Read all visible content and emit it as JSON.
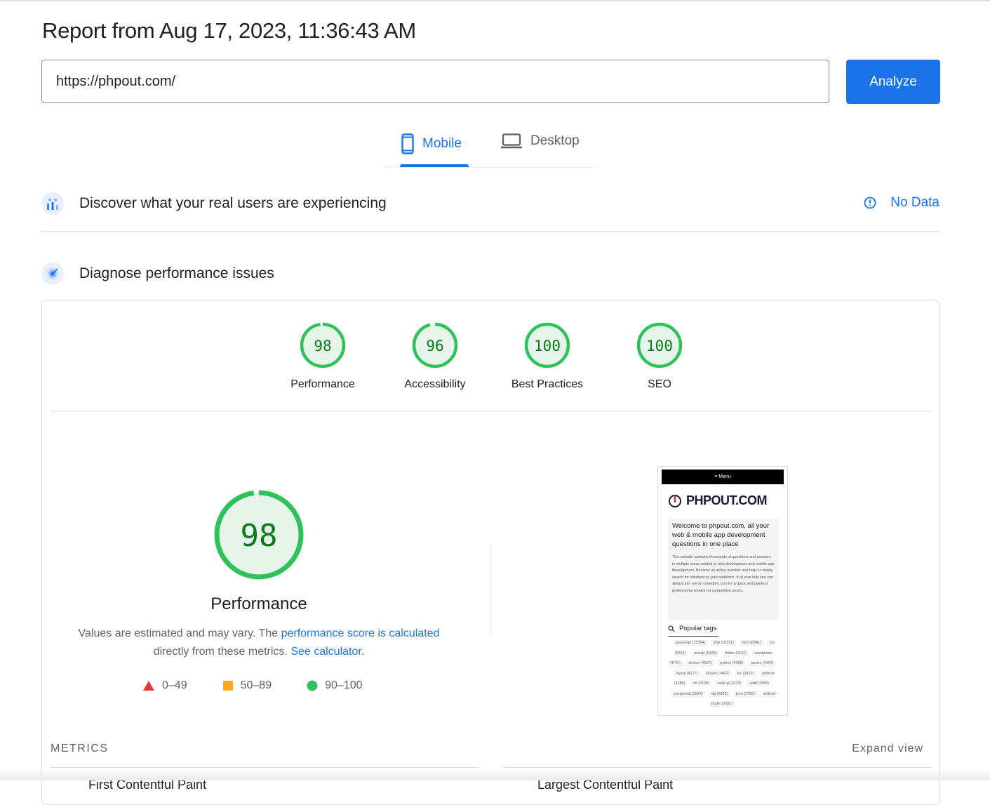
{
  "report": {
    "title": "Report from Aug 17, 2023, 11:36:43 AM"
  },
  "search": {
    "url_value": "https://phpout.com/",
    "analyze_label": "Analyze"
  },
  "tabs": [
    {
      "label": "Mobile",
      "icon": "smartphone-icon",
      "active": true
    },
    {
      "label": "Desktop",
      "icon": "laptop-icon",
      "active": false
    }
  ],
  "sections": {
    "real_users": {
      "title": "Discover what your real users are experiencing",
      "status": "No Data",
      "icon": "crux-chart-icon"
    },
    "diagnose": {
      "title": "Diagnose performance issues",
      "icon": "lighthouse-icon"
    }
  },
  "scores": [
    {
      "label": "Performance",
      "value": 98
    },
    {
      "label": "Accessibility",
      "value": 96
    },
    {
      "label": "Best Practices",
      "value": 100
    },
    {
      "label": "SEO",
      "value": 100
    }
  ],
  "performance": {
    "value": 98,
    "label": "Performance",
    "desc_prefix": "Values are estimated and may vary. The ",
    "desc_link": "performance score is calculated",
    "desc_mid": " directly from these metrics. ",
    "calc_link": "See calculator",
    "desc_suffix": "."
  },
  "legend": [
    {
      "shape": "triangle",
      "range": "0–49",
      "color": "#e53935"
    },
    {
      "shape": "square",
      "range": "50–89",
      "color": "#f9a825"
    },
    {
      "shape": "circle",
      "range": "90–100",
      "color": "#2fc25b"
    }
  ],
  "colors": {
    "accent": "#1a73e8",
    "pass": "#2fc25b",
    "pass_text": "#0a7a1c",
    "pass_fill": "#e6f4ea"
  },
  "screenshot": {
    "menu": "≡ Menu",
    "logo": "PHPOUT.COM",
    "welcome": "Welcome to phpout.com, all your web & mobile app development questions in one place",
    "body": "This website contains thousands of questions and answers in multiple areas related to web development and mobile app development. Become an active member and help or simply search for solutions to your problems. If all else fails you can always join me on codedpro.com for a quick and painless professional solution at competitive prices.",
    "tags_title": "Popular tags",
    "tags": [
      "javascript (13354)",
      "php (10331)",
      "html (8041)",
      "css (6324)",
      "reactjs (5349)",
      "flutter (5102)",
      "wordpress (4741)",
      "docker (4557)",
      "python (4496)",
      "jquery (4494)",
      "mysql (4177)",
      "laravel (3462)",
      "ios (3410)",
      "android (3280)",
      "c# (3190)",
      "node.js (3120)",
      "swift (2955)",
      "postgresql (2814)",
      "sql (2803)",
      "json (2756)",
      "android-studio (2691)"
    ]
  },
  "metrics": {
    "title": "METRICS",
    "expand_label": "Expand view",
    "first_metric": "First Contentful Paint",
    "second_metric": "Largest Contentful Paint"
  }
}
